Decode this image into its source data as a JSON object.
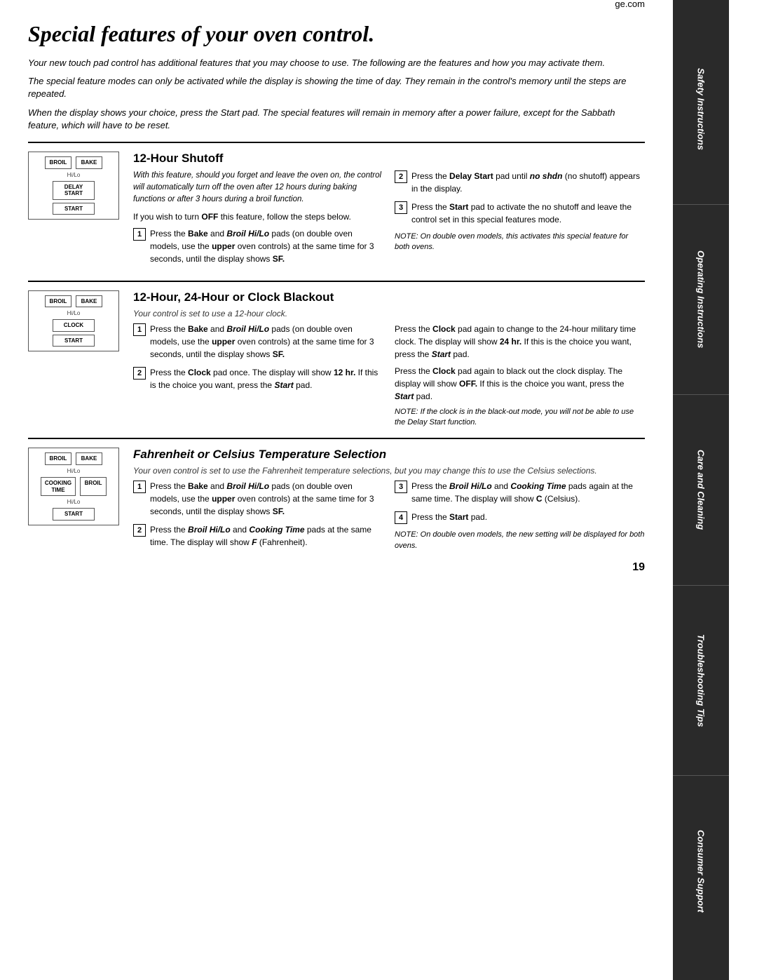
{
  "page": {
    "title": "Special features of your oven control.",
    "ge_com": "ge.com",
    "page_number": "19",
    "intro1": "Your new touch pad control has additional features that you may choose to use. The following are the features and how you may activate them.",
    "intro2": "The special feature modes can only be activated while the display is showing the time of day. They remain in the control's memory until the steps are repeated.",
    "intro3": "When the display shows your choice, press the Start pad. The special features will remain in memory after a power failure, except for the Sabbath feature, which will have to be reset."
  },
  "section1": {
    "title": "12-Hour Shutoff",
    "diagram": {
      "buttons": [
        {
          "row": [
            "BROIL",
            "BAKE"
          ],
          "labels": [
            "",
            ""
          ]
        },
        {
          "row": [
            "Hi/Lo"
          ],
          "labels": [
            ""
          ]
        },
        {
          "row": [
            "DELAY",
            "START"
          ],
          "labels": [
            ""
          ]
        },
        {
          "row": [
            "START"
          ],
          "labels": [
            ""
          ]
        }
      ]
    },
    "left_text": "With this feature, should you forget and leave the oven on, the control will automatically turn off the oven after 12 hours during baking functions or after 3 hours during a broil function.",
    "off_text": "If you wish to turn OFF this feature, follow the steps below.",
    "step1": "Press the Bake and Broil Hi/Lo pads (on double oven models, use the upper oven controls) at the same time for 3 seconds, until the display shows SF.",
    "step2": "Press the Delay Start pad until no shdn (no shutoff) appears in the display.",
    "step3": "Press the Start pad to activate the no shutoff and leave the control set in this special features mode.",
    "note": "NOTE: On double oven models, this activates this special feature for both ovens."
  },
  "section2": {
    "title": "12-Hour, 24-Hour or Clock Blackout",
    "subtitle": "Your control is set to use a 12-hour clock.",
    "step1": "Press the Bake and Broil Hi/Lo pads (on double oven models, use the upper oven controls) at the same time for 3 seconds, until the display shows SF.",
    "step2": "Press the Clock pad once. The display will show 12 hr. If this is the choice you want, press the Start pad.",
    "right1": "Press the Clock pad again to change to the 24-hour military time clock. The display will show 24 hr. If this is the choice you want, press the Start pad.",
    "right2": "Press the Clock pad again to black out the clock display. The display will show OFF. If this is the choice you want, press the Start pad.",
    "note": "NOTE: If the clock is in the black-out mode, you will not be able to use the Delay Start function."
  },
  "section3": {
    "title": "Fahrenheit or Celsius Temperature Selection",
    "subtitle": "Your oven control is set to use the Fahrenheit temperature selections, but you may change this to use the Celsius selections.",
    "step1": "Press the Bake and Broil Hi/Lo pads (on double oven models, use the upper oven controls) at the same time for 3 seconds, until the display shows SF.",
    "step2": "Press the Broil Hi/Lo and Cooking Time pads at the same time. The display will show F (Fahrenheit).",
    "step3": "Press the Broil Hi/Lo and Cooking Time pads again at the same time. The display will show C (Celsius).",
    "step4": "Press the Start pad.",
    "note": "NOTE: On double oven models, the new setting will be displayed for both ovens."
  },
  "sidebar": {
    "items": [
      "Safety Instructions",
      "Operating Instructions",
      "Care and Cleaning",
      "Troubleshooting Tips",
      "Consumer Support"
    ]
  }
}
